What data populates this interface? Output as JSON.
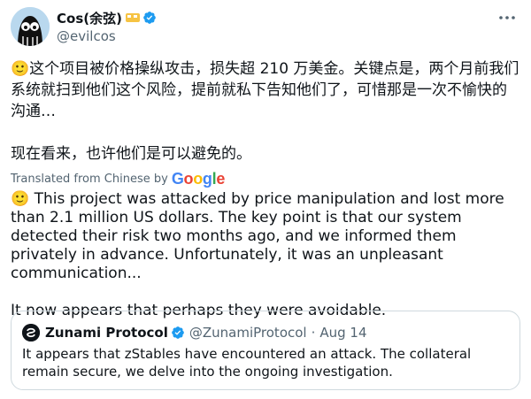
{
  "author": {
    "display_name": "Cos(余弦)",
    "handle": "@evilcos",
    "badge_emoji": "🫡",
    "verified": true
  },
  "tweet": {
    "chinese_paragraphs": [
      "🙂这个项目被价格操纵攻击，损失超 210 万美金。关键点是，两个月前我们系统就扫到他们这个风险，提前就私下告知他们了，可惜那是一次不愉快的沟通…",
      "现在看来，也许他们是可以避免的。"
    ],
    "translated_label": "Translated from Chinese by",
    "translator": "Google",
    "english_paragraphs": [
      "🙂 This project was attacked by price manipulation and lost more than 2.1 million US dollars. The key point is that our system detected their risk two months ago, and we informed them privately in advance. Unfortunately, it was an unpleasant communication...",
      "It now appears that perhaps they were avoidable."
    ]
  },
  "quote": {
    "name": "Zunami Protocol",
    "handle": "@ZunamiProtocol",
    "separator": "·",
    "date": "Aug 14",
    "text": "It appears that zStables have encountered an attack. The collateral remain secure, we delve into the ongoing investigation."
  },
  "colors": {
    "verified_blue": "#1d9bf0",
    "text_primary": "#0f1419",
    "text_secondary": "#536471",
    "border": "#cfd9de"
  }
}
